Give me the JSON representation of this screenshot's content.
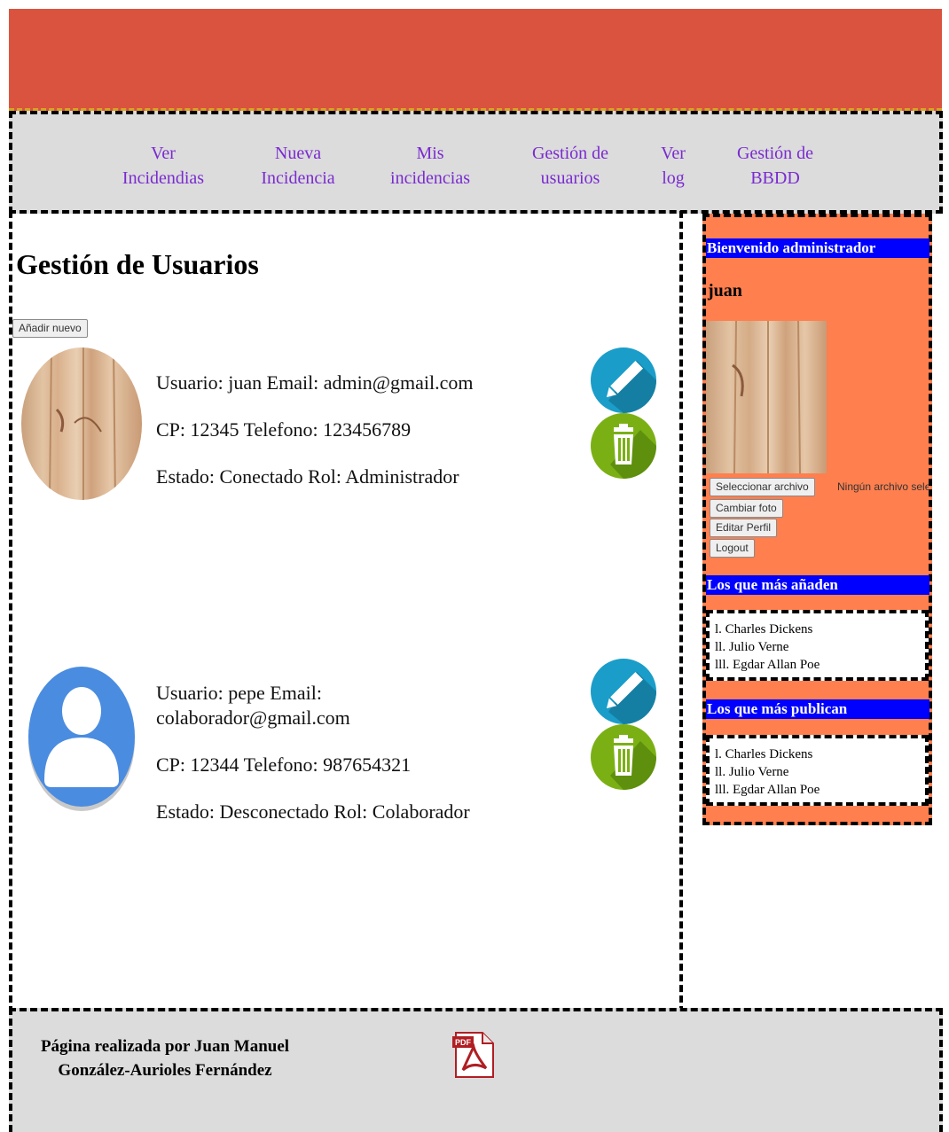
{
  "nav": {
    "items": [
      {
        "label": "Ver Incidendias"
      },
      {
        "label": "Nueva Incidencia"
      },
      {
        "label": "Mis incidencias"
      },
      {
        "label": "Gestión de usuarios"
      },
      {
        "label": "Ver log"
      },
      {
        "label": "Gestión de BBDD"
      }
    ]
  },
  "main": {
    "title": "Gestión de Usuarios",
    "add_button": "Añadir nuevo",
    "users": [
      {
        "line1": "Usuario: juan Email: admin@gmail.com",
        "line2": "CP: 12345 Telefono: 123456789",
        "line3": "Estado: Conectado Rol: Administrador",
        "avatar": "wood-photo"
      },
      {
        "line1": "Usuario: pepe Email: colaborador@gmail.com",
        "line2": "CP: 12344 Telefono: 987654321",
        "line3": "Estado: Desconectado Rol: Colaborador",
        "avatar": "default-user-icon"
      }
    ],
    "edit_icon": "pencil-icon",
    "delete_icon": "trash-icon"
  },
  "sidebar": {
    "welcome": "Bienvenido administrador",
    "username": "juan",
    "file_button": "Seleccionar archivo",
    "file_status": "Ningún archivo seleccionado",
    "change_photo": "Cambiar foto",
    "edit_profile": "Editar Perfil",
    "logout": "Logout",
    "top_adders_title": "Los que más añaden",
    "top_adders": [
      "l. Charles Dickens",
      "ll. Julio Verne",
      "lll. Egdar Allan Poe"
    ],
    "top_publishers_title": "Los que más publican",
    "top_publishers": [
      "l. Charles Dickens",
      "ll. Julio Verne",
      "lll. Egdar Allan Poe"
    ]
  },
  "footer": {
    "credit": "Página realizada por Juan Manuel González-Aurioles Fernández",
    "pdf_icon": "pdf-icon"
  },
  "colors": {
    "header": "#d9533e",
    "nav_bg": "#dcdcdc",
    "link": "#7a2bd0",
    "sidebar_bg": "#ff7f4f",
    "sidebar_heading": "#0000ff",
    "edit_button": "#1a9dc9",
    "delete_button": "#7bb015"
  }
}
